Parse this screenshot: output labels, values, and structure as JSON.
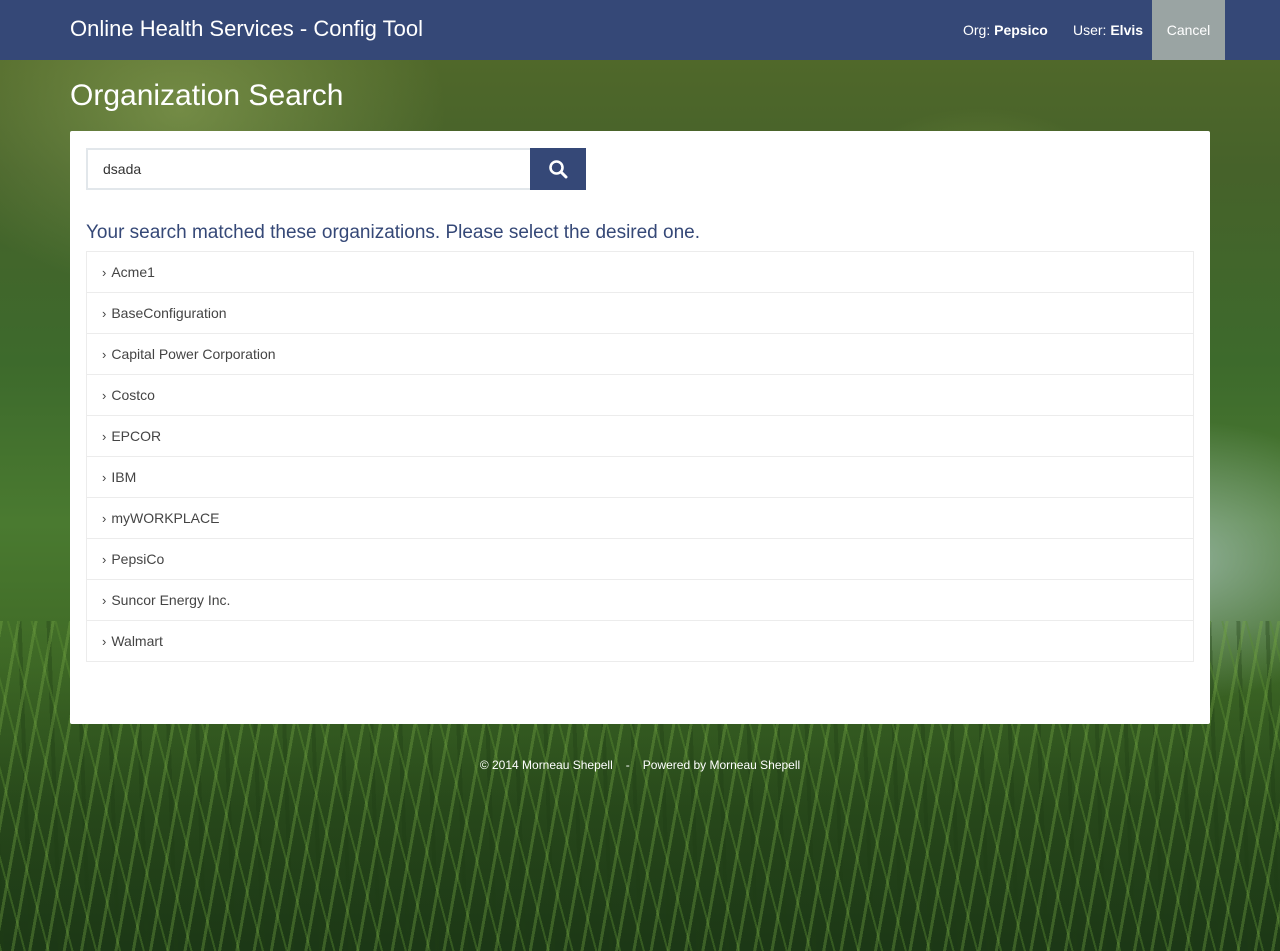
{
  "header": {
    "brand": "Online Health Services - Config Tool",
    "org_label": "Org:",
    "org_value": "Pepsico",
    "user_label": "User:",
    "user_value": "Elvis",
    "cancel_label": "Cancel"
  },
  "page": {
    "title": "Organization Search"
  },
  "search": {
    "value": "dsada",
    "button_icon": "search-icon"
  },
  "results": {
    "message": "Your search matched these organizations. Please select the desired one.",
    "items": [
      "Acme1",
      "BaseConfiguration",
      "Capital Power Corporation",
      "Costco",
      "EPCOR",
      "IBM",
      "myWORKPLACE",
      "PepsiCo",
      "Suncor Energy Inc.",
      "Walmart"
    ]
  },
  "footer": {
    "copyright": "© 2014 Morneau Shepell",
    "separator": "-",
    "powered": "Powered by Morneau Shepell"
  },
  "colors": {
    "navbar": "#354877",
    "cancel": "#9aa4a3",
    "accent": "#354877"
  }
}
